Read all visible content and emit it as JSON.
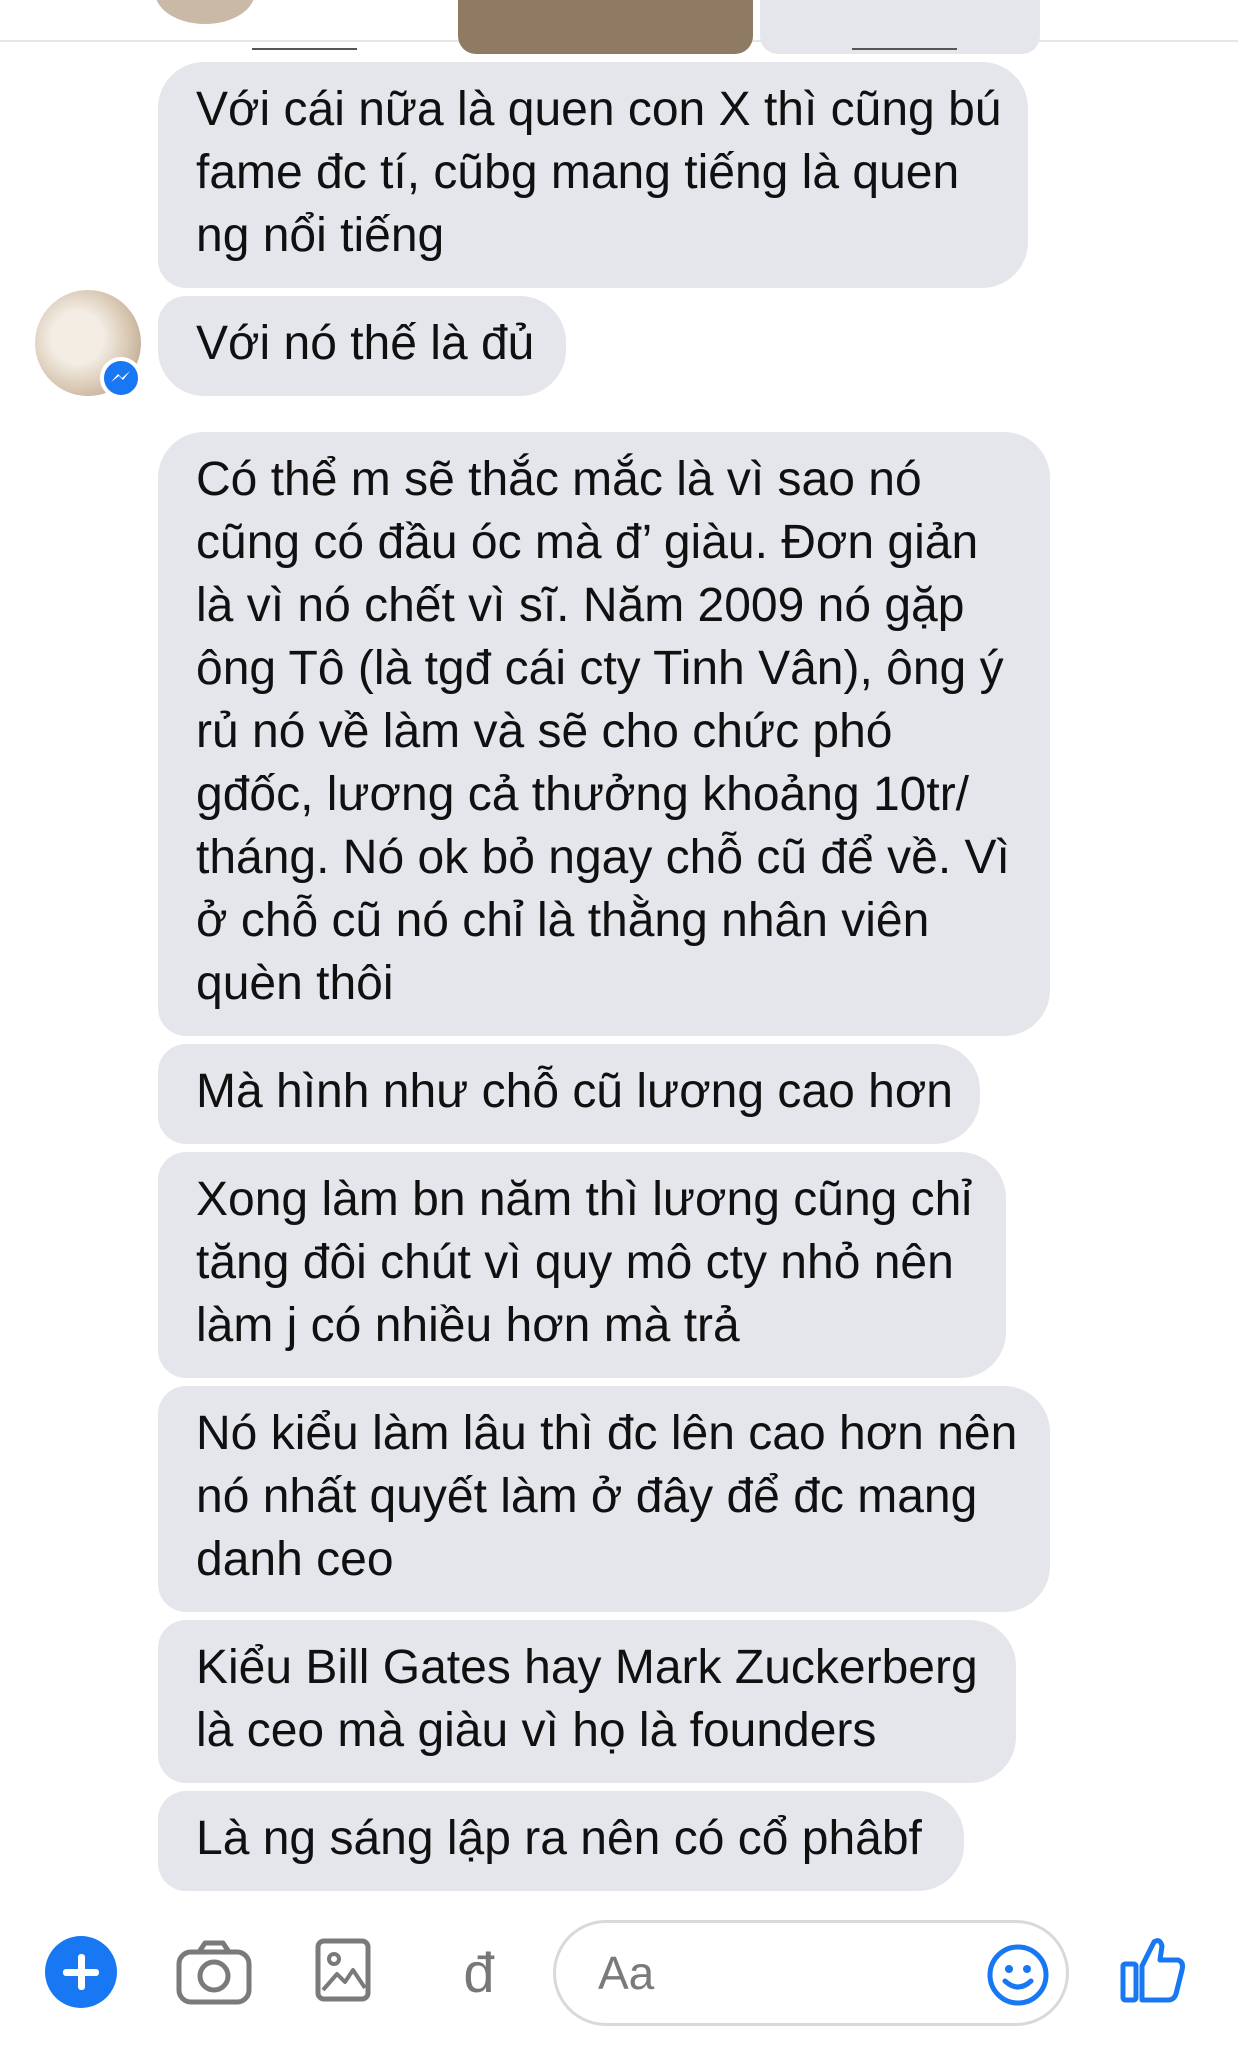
{
  "messages": [
    {
      "lines": [
        "Với cái nữa là quen con X thì cũng bú",
        "fame đc tí, cũbg mang tiếng là quen",
        "ng nổi tiếng"
      ]
    },
    {
      "lines": [
        "Với nó thế là đủ"
      ]
    },
    {
      "lines": [
        "Có thể m sẽ thắc mắc là vì sao nó",
        "cũng có đầu óc mà đ’ giàu. Đơn giản",
        "là vì nó chết vì sĩ.  Năm 2009 nó gặp",
        "ông Tô (là tgđ cái cty Tinh Vân), ông ý",
        "rủ nó về làm và sẽ cho chức phó",
        "gđốc, lương cả thưởng khoảng 10tr/",
        "tháng. Nó ok bỏ ngay chỗ cũ để về. Vì",
        "ở chỗ cũ nó chỉ là thằng nhân viên",
        "quèn thôi"
      ]
    },
    {
      "lines": [
        "Mà hình như chỗ cũ lương cao hơn"
      ]
    },
    {
      "lines": [
        "Xong làm bn năm thì lương cũng chỉ",
        "tăng đôi chút vì quy mô cty nhỏ nên",
        "làm j có nhiều hơn mà trả"
      ]
    },
    {
      "lines": [
        "Nó kiểu làm lâu thì đc lên cao hơn nên",
        "nó nhất quyết làm ở đây để đc mang",
        "danh ceo"
      ]
    },
    {
      "lines": [
        "Kiểu Bill Gates hay Mark Zuckerberg",
        "là ceo mà giàu vì họ là founders"
      ]
    },
    {
      "lines": [
        "Là ng sáng lập ra nên có cổ phâbf"
      ]
    }
  ],
  "compose": {
    "placeholder": "Aa",
    "dd_glyph": "đ"
  },
  "icons": {
    "plus": "plus-icon",
    "camera": "camera-icon",
    "gallery": "gallery-icon",
    "emoji": "emoji-icon",
    "like": "thumbs-up-icon",
    "messenger_badge": "messenger-icon"
  },
  "colors": {
    "bubble": "#e4e6eb",
    "accent": "#1877f2",
    "text": "#101010"
  }
}
